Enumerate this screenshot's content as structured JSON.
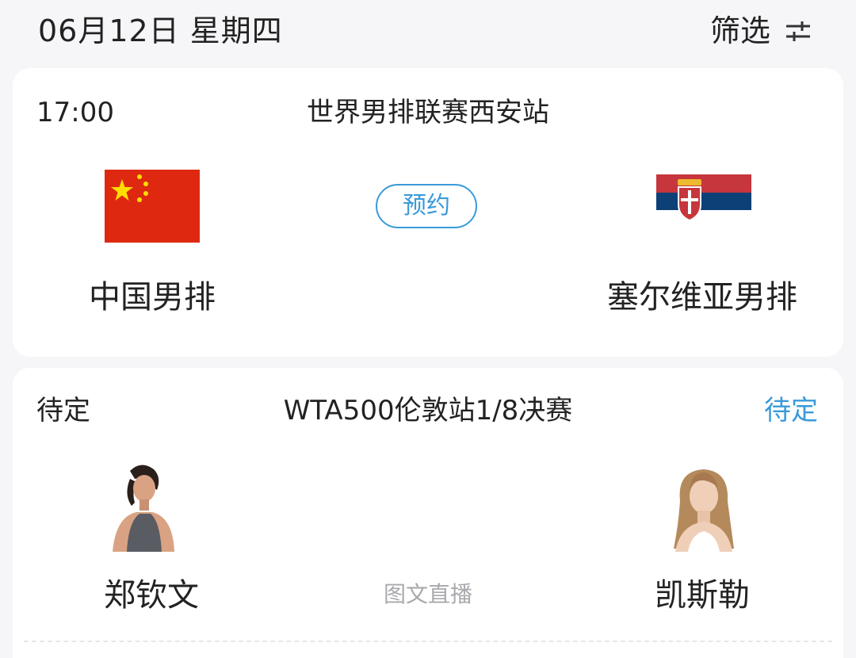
{
  "header": {
    "date": "06月12日 星期四",
    "filter_label": "筛选",
    "filter_icon": "sliders-icon"
  },
  "matches": [
    {
      "time": "17:00",
      "event": "世界男排联赛西安站",
      "action_label": "预约",
      "home": {
        "name": "中国男排",
        "flag": "china-flag"
      },
      "away": {
        "name": "塞尔维亚男排",
        "flag": "serbia-flag"
      }
    },
    {
      "time": "待定",
      "event": "WTA500伦敦站1/8决赛",
      "status": "待定",
      "live_label": "图文直播",
      "home": {
        "name": "郑钦文",
        "photo": "player-photo"
      },
      "away": {
        "name": "凯斯勒",
        "photo": "player-photo"
      }
    }
  ],
  "colors": {
    "accent": "#3a9ad9",
    "background": "#f6f6f8",
    "card": "#ffffff",
    "muted": "#a9a9ad"
  }
}
